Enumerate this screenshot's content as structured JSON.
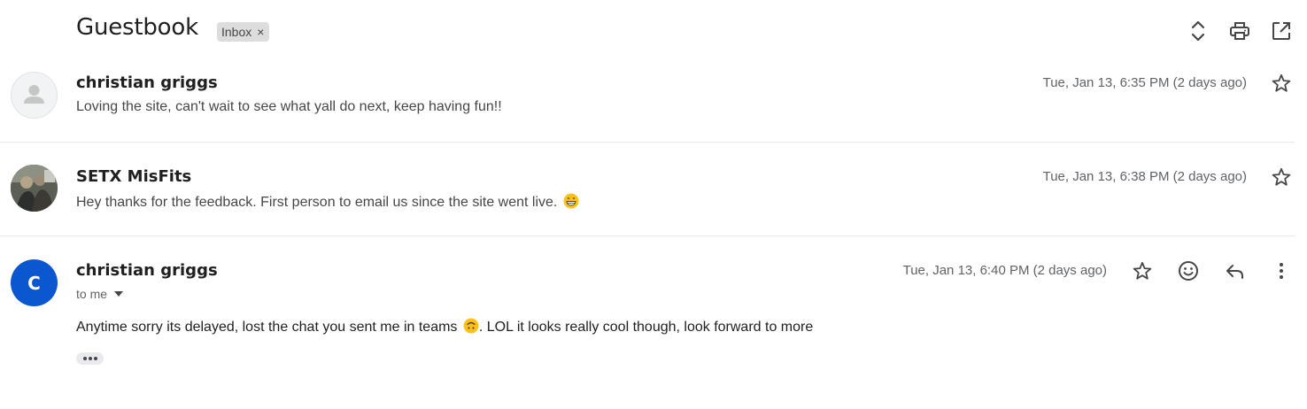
{
  "header": {
    "subject": "Guestbook",
    "label": "Inbox",
    "label_remove": "×",
    "icons": [
      "expand-collapse-icon",
      "print-icon",
      "open-in-new-window-icon"
    ]
  },
  "messages": [
    {
      "sender": "christian griggs",
      "snippet": "Loving the site, can't wait to see what yall do next, keep having fun!!",
      "date": "Tue, Jan 13, 6:35 PM (2 days ago)",
      "avatar": "default-person-icon"
    },
    {
      "sender": "SETX MisFits",
      "snippet": "Hey thanks for the feedback. First person to email us since the site went live.",
      "snippet_emoji": "grinning-face-icon",
      "date": "Tue, Jan 13, 6:38 PM (2 days ago)",
      "avatar": "profile-photo"
    },
    {
      "sender": "christian griggs",
      "avatar_letter": "C",
      "avatar_color": "#0b57d0",
      "recipient": "to me",
      "body_part1": "Anytime sorry its delayed, lost the chat you sent me in teams",
      "body_emoji": "upside-down-face-icon",
      "body_part2": ". LOL it looks really cool though, look forward to more",
      "date": "Tue, Jan 13, 6:40 PM (2 days ago)",
      "actions": [
        "star-icon",
        "add-reaction-icon",
        "reply-icon",
        "more-options-icon"
      ]
    }
  ],
  "colors": {
    "chip_bg": "#dddddd",
    "avatar_blue": "#0b57d0",
    "divider": "#e8eaed"
  }
}
